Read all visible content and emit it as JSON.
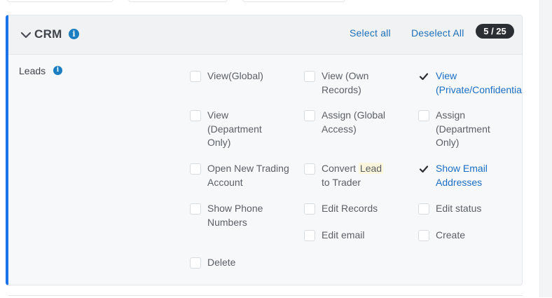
{
  "card": {
    "title": "CRM",
    "select_all": "Select all",
    "deselect_all": "Deselect All",
    "count": "5 / 25",
    "accent_color": "#1a73e8"
  },
  "section": {
    "label": "Leads"
  },
  "permissions": [
    {
      "label": "View(Global)",
      "checked": false
    },
    {
      "label": "View (Own Records)",
      "checked": false
    },
    {
      "label": "View (Private/Confidential)",
      "checked": true
    },
    {
      "label": "View (Department Only)",
      "checked": false
    },
    {
      "label": "Assign (Global Access)",
      "checked": false
    },
    {
      "label": "Assign (Department Only)",
      "checked": false
    },
    {
      "label": "Open New Trading Account",
      "checked": false
    },
    {
      "label": "Convert Lead to Trader",
      "checked": false
    },
    {
      "label": "Show Email Addresses",
      "checked": true
    },
    {
      "label": "Show Phone Numbers",
      "checked": false
    },
    {
      "label": "Edit Records",
      "checked": false
    },
    {
      "label": "Edit status",
      "checked": false
    },
    {
      "label": "Edit email",
      "checked": false
    },
    {
      "label": "Create",
      "checked": false
    },
    {
      "label": "Delete",
      "checked": false
    }
  ],
  "convert_lead_parts": [
    "Convert",
    "Lead",
    "to Trader"
  ]
}
